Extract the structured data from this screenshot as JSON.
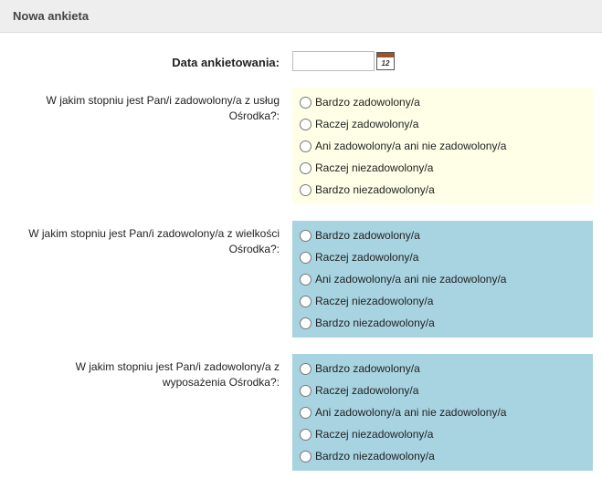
{
  "header": {
    "title": "Nowa ankieta"
  },
  "form": {
    "date": {
      "label": "Data ankietowania:",
      "value": ""
    },
    "calendar_icon_text": "12",
    "questions": [
      {
        "label": "W jakim stopniu jest Pan/i zadowolony/a z usług Ośrodka?:",
        "options": [
          "Bardzo zadowolony/a",
          "Raczej zadowolony/a",
          "Ani zadowolony/a ani nie zadowolony/a",
          "Raczej niezadowolony/a",
          "Bardzo niezadowolony/a"
        ]
      },
      {
        "label": "W jakim stopniu jest Pan/i zadowolony/a z wielkości Ośrodka?:",
        "options": [
          "Bardzo zadowolony/a",
          "Raczej zadowolony/a",
          "Ani zadowolony/a ani nie zadowolony/a",
          "Raczej niezadowolony/a",
          "Bardzo niezadowolony/a"
        ]
      },
      {
        "label": "W jakim stopniu jest Pan/i zadowolony/a z wyposażenia Ośrodka?:",
        "options": [
          "Bardzo zadowolony/a",
          "Raczej zadowolony/a",
          "Ani zadowolony/a ani nie zadowolony/a",
          "Raczej niezadowolony/a",
          "Bardzo niezadowolony/a"
        ]
      }
    ]
  }
}
